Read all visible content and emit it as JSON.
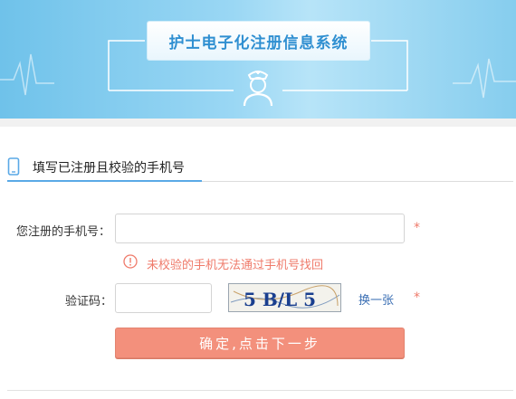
{
  "header": {
    "title": "护士电子化注册信息系统"
  },
  "section": {
    "title": "填写已注册且校验的手机号"
  },
  "form": {
    "phone_label": "您注册的手机号：",
    "phone_value": "",
    "phone_required": "*",
    "warning": "未校验的手机无法通过手机号找回",
    "captcha_label": "验证码：",
    "captcha_value": "",
    "captcha_text": "5 B/L 5",
    "refresh_label": "换一张",
    "captcha_required": "*",
    "submit_label": "确定,点击下一步"
  },
  "colors": {
    "accent": "#2f8fd1",
    "warning": "#ef7a6a",
    "submit": "#f3907c",
    "link": "#3b6fb4"
  }
}
